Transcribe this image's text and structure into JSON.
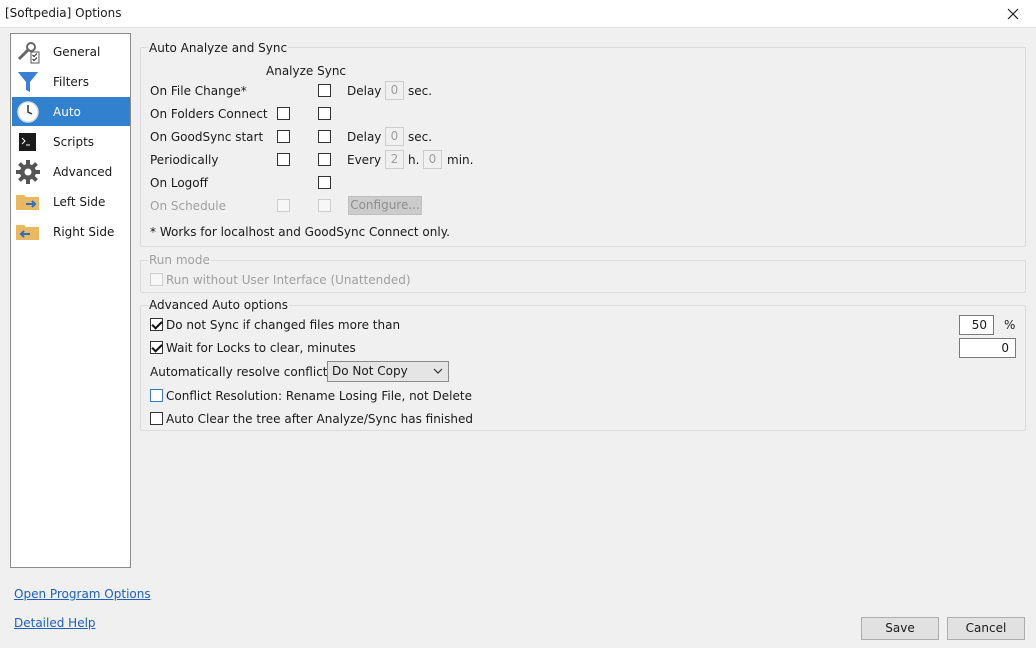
{
  "window": {
    "title": "[Softpedia] Options"
  },
  "sidebar": {
    "selected_index": 2,
    "items": [
      {
        "label": "General",
        "icon": "wrench-checklist-icon"
      },
      {
        "label": "Filters",
        "icon": "funnel-icon"
      },
      {
        "label": "Auto",
        "icon": "clock-icon"
      },
      {
        "label": "Scripts",
        "icon": "terminal-icon"
      },
      {
        "label": "Advanced",
        "icon": "gear-icon"
      },
      {
        "label": "Left Side",
        "icon": "folder-arrow-right-icon"
      },
      {
        "label": "Right Side",
        "icon": "folder-arrow-left-icon"
      }
    ]
  },
  "auto_group": {
    "title": "Auto Analyze and Sync",
    "col_headers": "Analyze Sync",
    "rows": [
      {
        "label": "On File Change*",
        "analyze": false,
        "sync": false,
        "extra_label": "Delay",
        "value": "0",
        "unit": "sec."
      },
      {
        "label": "On Folders Connect",
        "analyze": false,
        "sync": false
      },
      {
        "label": "On GoodSync start",
        "analyze": false,
        "sync": false,
        "extra_label": "Delay",
        "value": "0",
        "unit": "sec."
      },
      {
        "label": "Periodically",
        "analyze": false,
        "sync": false,
        "extra_label": "Every",
        "hours": "2",
        "hours_unit": "h.",
        "minutes": "0",
        "minutes_unit": "min."
      },
      {
        "label": "On Logoff",
        "sync": false
      },
      {
        "label": "On Schedule",
        "disabled": true,
        "button": "Configure..."
      }
    ],
    "footnote": "* Works for localhost and GoodSync Connect only."
  },
  "run_mode": {
    "title": "Run mode",
    "option": "Run without User Interface (Unattended)",
    "checked": false
  },
  "advanced_auto": {
    "title": "Advanced Auto options",
    "no_sync_label": "Do not Sync if changed files more than",
    "no_sync_checked": true,
    "no_sync_value": "50",
    "no_sync_unit": "%",
    "wait_locks_label": "Wait for Locks to clear, minutes",
    "wait_locks_checked": true,
    "wait_locks_value": "0",
    "resolve_label": "Automatically resolve conflicts",
    "resolve_value": "Do Not Copy",
    "rename_label": "Conflict Resolution: Rename Losing File, not Delete",
    "rename_checked": false,
    "autoclear_label": "Auto Clear the tree after Analyze/Sync has finished",
    "autoclear_checked": false
  },
  "footer": {
    "open_program_options": "Open Program Options",
    "detailed_help": "Detailed Help",
    "save": "Save",
    "cancel": "Cancel"
  },
  "colors": {
    "selection": "#3281cf",
    "link": "#1f5fbf"
  }
}
